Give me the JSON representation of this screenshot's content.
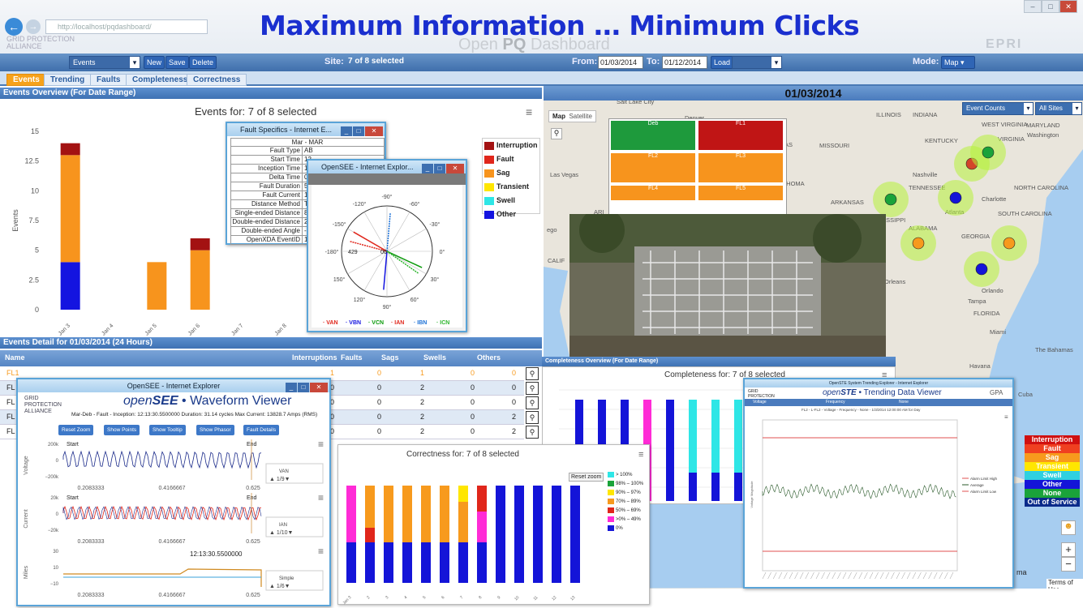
{
  "browser": {
    "url": "http://localhost/pqdashboard/",
    "slogan": "Maximum Information  …  Minimum Clicks",
    "app_title_prefix": "Open ",
    "app_title_bold": "PQ",
    "app_title_suffix": " Dashboard",
    "gpa_logo": "GRID PROTECTION ALLIANCE",
    "epri_logo": "EPRI"
  },
  "toolbar": {
    "view_select": "Events",
    "new_label": "New",
    "save_label": "Save",
    "delete_label": "Delete",
    "site_label": "Site:",
    "site_value": "7 of 8 selected",
    "from_label": "From:",
    "from_value": "01/03/2014",
    "to_label": "To:",
    "to_value": "01/12/2014",
    "load_label": "Load",
    "mode_label": "Mode:",
    "mode_value": "Map"
  },
  "tabs": [
    "Events",
    "Trending",
    "Faults",
    "Completeness",
    "Correctness"
  ],
  "events_overview": {
    "header": "Events Overview (For Date Range)",
    "chart_title": "Events for: 7 of 8 selected",
    "legend": [
      {
        "name": "Interruption",
        "color": "#a31212"
      },
      {
        "name": "Fault",
        "color": "#e0261b"
      },
      {
        "name": "Sag",
        "color": "#f7941d"
      },
      {
        "name": "Transient",
        "color": "#ffe600"
      },
      {
        "name": "Swell",
        "color": "#2ee6e6"
      },
      {
        "name": "Other",
        "color": "#1414e0"
      }
    ]
  },
  "chart_data": [
    {
      "type": "bar",
      "title": "Events for: 7 of 8 selected",
      "ylabel": "Events",
      "ylim": [
        0,
        15
      ],
      "yticks": [
        "0",
        "2.5",
        "5",
        "7.5",
        "10",
        "12.5",
        "15"
      ],
      "categories": [
        "Jan 3",
        "Jan 4",
        "Jan 5",
        "Jan 6",
        "Jan 7",
        "Jan 8"
      ],
      "series": [
        {
          "name": "Other",
          "values": [
            4,
            0,
            0,
            0,
            0,
            0
          ]
        },
        {
          "name": "Sag",
          "values": [
            9,
            0,
            4,
            5,
            0,
            0
          ]
        },
        {
          "name": "Interruption",
          "values": [
            1,
            0,
            0,
            1,
            0,
            0
          ]
        }
      ]
    },
    {
      "type": "bar",
      "title": "Completeness for: 7 of 8 selected",
      "categories": [
        "1",
        "2",
        "3",
        "4",
        "5",
        "6",
        "7",
        "8",
        "9",
        "10",
        "11",
        "12",
        "13",
        "14"
      ],
      "series": [
        {
          "name": "blue",
          "values": [
            1,
            1,
            1,
            0,
            1,
            0,
            0,
            0,
            0,
            0,
            0,
            0,
            0,
            0
          ]
        },
        {
          "name": "magenta",
          "values": [
            0,
            0,
            0,
            1,
            0,
            0,
            0,
            0,
            0,
            0,
            0,
            0,
            0,
            0
          ]
        },
        {
          "name": "cyan",
          "values": [
            0,
            0,
            0,
            0,
            0,
            1,
            1,
            1,
            1,
            1,
            1,
            1,
            1,
            1
          ]
        }
      ]
    },
    {
      "type": "bar",
      "title": "Correctness for: 7 of 8 selected",
      "categories": [
        "Jan 3",
        "2",
        "3",
        "4",
        "5",
        "6",
        "7",
        "8",
        "9",
        "10",
        "11",
        "12",
        "13"
      ],
      "legend": [
        "> 100%",
        "98% – 100%",
        "90% – 97%",
        "70% – 89%",
        "50% – 69%",
        ">0% – 49%",
        "0%"
      ]
    }
  ],
  "fault_window": {
    "title": "Fault Specifics - Internet E...",
    "header": "Mar - MAR",
    "rows": [
      {
        "k": "Fault Type",
        "v": "AB"
      },
      {
        "k": "Start Time",
        "v": "12"
      },
      {
        "k": "Inception Time",
        "v": "12"
      },
      {
        "k": "Delta Time",
        "v": "0."
      },
      {
        "k": "Fault Duration",
        "v": "5"
      },
      {
        "k": "Fault Current",
        "v": "1"
      },
      {
        "k": "Distance Method",
        "v": "T"
      },
      {
        "k": "Single-ended Distance",
        "v": "8"
      },
      {
        "k": "Double-ended Distance",
        "v": "2"
      },
      {
        "k": "Double-ended Angle",
        "v": "-"
      },
      {
        "k": "OpenXDA EventID",
        "v": "1"
      }
    ]
  },
  "opensee_small": {
    "title": "OpenSEE - Internet Explor...",
    "angles": [
      "-90°",
      "-60°",
      "-120°",
      "-30°",
      "-150°",
      "0°",
      "-180°",
      "30°",
      "150°",
      "60°",
      "120°",
      "90°"
    ],
    "center_labels": [
      "429",
      "06"
    ],
    "legend": [
      {
        "name": "VAN",
        "color": "#e0261b"
      },
      {
        "name": "VBN",
        "color": "#1414e0"
      },
      {
        "name": "VCN",
        "color": "#0a9a0a"
      },
      {
        "name": "IAN",
        "color": "#e0261b"
      },
      {
        "name": "IBN",
        "color": "#1a6fd6"
      },
      {
        "name": "ICN",
        "color": "#2bb52b"
      }
    ]
  },
  "map": {
    "date": "01/03/2014",
    "tab_map": "Map",
    "tab_satellite": "Satellite",
    "event_counts": "Event Counts",
    "all_sites": "All Sites",
    "labels": [
      "ILLINOIS",
      "INDIANA",
      "MISSOURI",
      "KENTUCKY",
      "VIRGINIA",
      "MARYLAND",
      "Washington",
      "WEST VIRGINIA",
      "Nashville",
      "TENNESSEE",
      "NORTH CAROLINA",
      "Charlotte",
      "ARKANSAS",
      "SOUTH CAROLINA",
      "Atlanta",
      "GEORGIA",
      "ALABAMA",
      "ISSIPPI",
      "Orleans",
      "Orlando",
      "Tampa",
      "FLORIDA",
      "Miami",
      "The Bahamas",
      "Havana",
      "Cuba",
      "Las Vegas",
      "Denver",
      "KLAHOMA",
      "CALIF",
      "Salt Lake City",
      "SAS",
      "ego",
      "ARI"
    ],
    "tiles": [
      {
        "label": "Deb",
        "color": "#1e9a3c"
      },
      {
        "label": "FL1",
        "color": "#c01515"
      },
      {
        "label": "FL2",
        "color": "#f7941d"
      },
      {
        "label": "FL3",
        "color": "#f7941d"
      },
      {
        "label": "FL4",
        "color": "#f7941d"
      },
      {
        "label": "FL5",
        "color": "#f7941d"
      }
    ],
    "status_legend": [
      {
        "name": "Interruption",
        "color": "#d01010"
      },
      {
        "name": "Fault",
        "color": "#f04020"
      },
      {
        "name": "Sag",
        "color": "#f79a1d"
      },
      {
        "name": "Transient",
        "color": "#ffe600"
      },
      {
        "name": "Swell",
        "color": "#2fd0e0"
      },
      {
        "name": "Other",
        "color": "#1414d8"
      },
      {
        "name": "None",
        "color": "#1aa33a"
      },
      {
        "name": "Out of Service",
        "color": "#0a2a8a"
      }
    ],
    "zoom_in": "+",
    "zoom_out": "−",
    "terms": "Terms of Use",
    "ma": "ma"
  },
  "events_detail": {
    "header": "Events Detail for 01/03/2014 (24 Hours)",
    "columns": [
      "Name",
      "Interruptions",
      "Faults",
      "Sags",
      "Swells",
      "Others"
    ],
    "rows": [
      {
        "name": "FL1",
        "interruptions": "1",
        "faults": "0",
        "sags": "1",
        "swells": "0",
        "others": "0"
      },
      {
        "name": "FL",
        "interruptions": "0",
        "faults": "0",
        "sags": "2",
        "swells": "0",
        "others": "0"
      },
      {
        "name": "FL",
        "interruptions": "0",
        "faults": "0",
        "sags": "2",
        "swells": "0",
        "others": "0"
      },
      {
        "name": "FL",
        "interruptions": "0",
        "faults": "0",
        "sags": "2",
        "swells": "0",
        "others": "2"
      },
      {
        "name": "FL",
        "interruptions": "0",
        "faults": "0",
        "sags": "2",
        "swells": "0",
        "others": "2"
      }
    ]
  },
  "opensee_big": {
    "window_title": "OpenSEE - Internet Explorer",
    "gpa": "GRID PROTECTION ALLIANCE",
    "title_open": "open",
    "title_see": "SEE",
    "title_rest": " • Waveform Viewer",
    "info": "Mar-Deb - Fault - Inception: 12:13:30.5500000   Duration: 31.14 cycles   Max Current: 13828.7 Amps (RMS)",
    "buttons": [
      "Reset Zoom",
      "Show Points",
      "Show Tooltip",
      "Show Phasor",
      "Fault Details"
    ],
    "voltage": {
      "ylabel": "Voltage",
      "yticks": [
        "200k",
        "0",
        "−200k"
      ],
      "start": "Start",
      "end": "End",
      "legend": "VAN",
      "pager": "1/9"
    },
    "current": {
      "ylabel": "Current",
      "yticks": [
        "20k",
        "0",
        "−20k"
      ],
      "start": "Start",
      "end": "End",
      "legend": "IAN",
      "pager": "1/10"
    },
    "miles": {
      "ylabel": "Miles",
      "yticks": [
        "30",
        "10",
        "−10"
      ],
      "time": "12:13:30.5500000",
      "legend": "Simple",
      "pager": "1/6"
    },
    "xticks": [
      "0.2083333",
      "0.4166667",
      "0.625"
    ]
  },
  "completeness": {
    "header": "Completeness Overview (For Date Range)",
    "title": "Completeness for: 7 of 8 selected"
  },
  "correctness": {
    "title": "Correctness for: 7 of 8 selected",
    "reset_zoom": "Reset zoom"
  },
  "openste": {
    "window_title": "OpenSTE System Trending Explorer - Internet Explorer",
    "gpa": "GRID PROTECTION ALLIANCE",
    "title_open": "open",
    "title_ste": "STE",
    "title_rest": " • Trending Data Viewer",
    "selects": [
      "Voltage",
      "Frequency",
      "None"
    ],
    "subtitle": "FL2 - L-FL2 - Voltage - Frequency - None - 1/3/2014 12:00:00 AM for Day",
    "ylabel": "Voltage Magnitude",
    "legend": [
      "Alarm Limit High",
      "Average",
      "Alarm Limit Low"
    ],
    "gpa_right": "GPA"
  }
}
